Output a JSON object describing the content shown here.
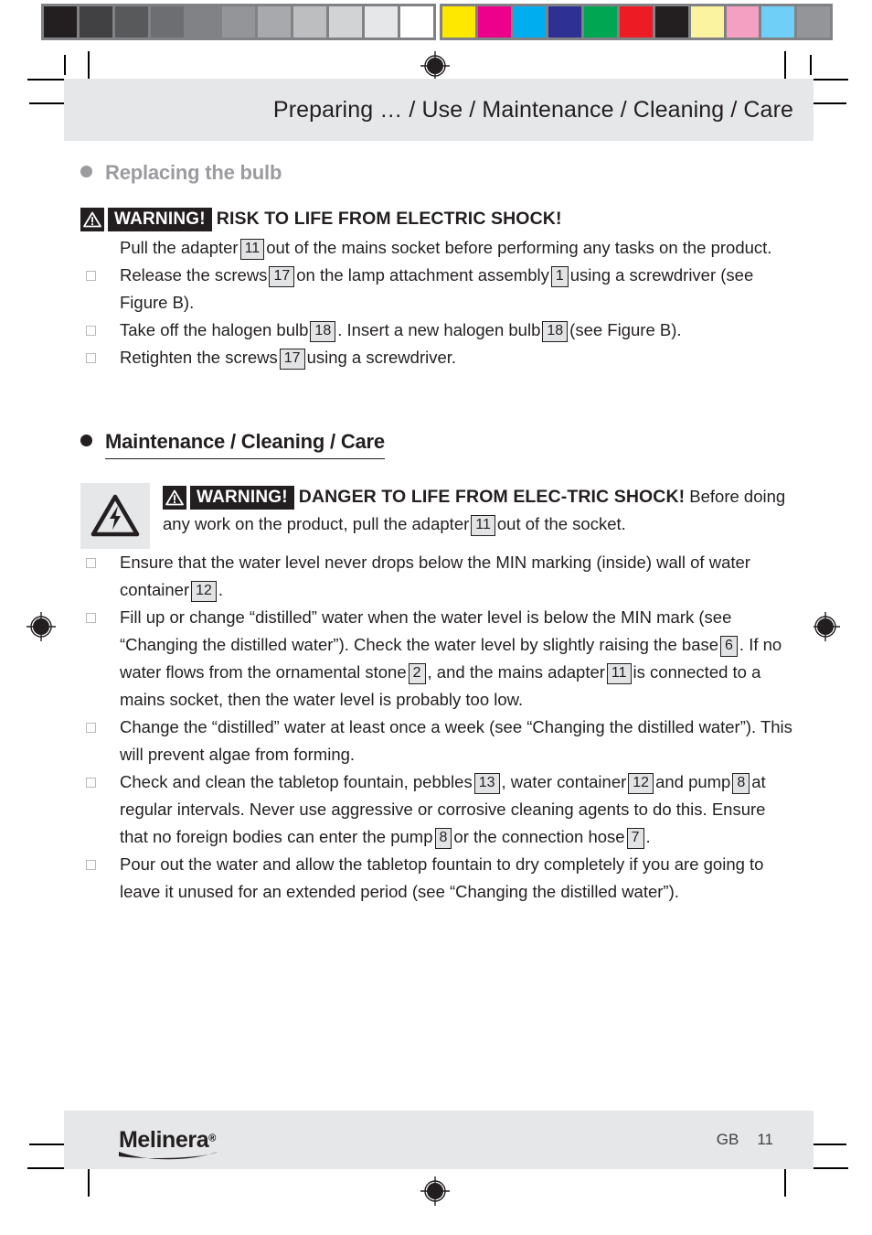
{
  "calibration": {
    "gray_ramp": [
      "#231f20",
      "#414042",
      "#58595b",
      "#6d6e71",
      "#808285",
      "#939598",
      "#a7a9ac",
      "#bcbec0",
      "#d1d3d4",
      "#e6e7e8",
      "#ffffff"
    ],
    "color_ramp": [
      "#ffe800",
      "#ec008c",
      "#00aeef",
      "#2e3192",
      "#00a651",
      "#ed1c24",
      "#231f20",
      "#fbf3a0",
      "#f4a0c2",
      "#6fcff6",
      "#939598"
    ],
    "strip_border": "#808285"
  },
  "header": {
    "title": "Preparing … / Use / Maintenance / Cleaning / Care",
    "background": "#e6e7e9"
  },
  "sections": [
    {
      "id": "replacing-the-bulb",
      "heading": "Replacing the bulb",
      "state": "continued",
      "color": "#9b9ba0"
    },
    {
      "id": "maintenance-cleaning-care",
      "heading": "Maintenance / Cleaning / Care",
      "state": "current",
      "color": "#231f20"
    }
  ],
  "warning_bulb": {
    "icon_label": "warning-triangle",
    "word": "WARNING!",
    "headline": "RISK TO LIFE FROM ELECTRIC SHOCK!",
    "body_before": "Pull the adapter",
    "ref": "11",
    "body_after": "out of the mains socket before performing any tasks on the product."
  },
  "bulb_steps": [
    {
      "p1": "Release the screws",
      "r1": "17",
      "p2": "on the lamp attachment assembly",
      "r2": "1",
      "p3": "using a screwdriver (see Figure B)."
    },
    {
      "p1": "Take off the halogen bulb",
      "r1": "18",
      "p2": ". Insert a new halogen bulb",
      "r2": "18",
      "p3": "(see Figure B)."
    },
    {
      "p1": "Retighten the screws",
      "r1": "17",
      "p2": "using a screwdriver.",
      "r2": "",
      "p3": ""
    }
  ],
  "warning_maintenance": {
    "icon_label": "electric-shock-triangle",
    "word": "WARNING!",
    "headline_1": "DANGER TO LIFE FROM ELEC-",
    "headline_2": "TRIC SHOCK!",
    "body_before": "Before doing any work on the product, pull the adapter",
    "ref": "11",
    "body_after": "out of the socket."
  },
  "maintenance_steps": [
    {
      "p1": "Ensure that the water level never drops below the MIN marking (inside) wall of water container",
      "r1": "12",
      "p2": ".",
      "r2": "",
      "p3": "",
      "r3": "",
      "p4": "",
      "r4": "",
      "p5": ""
    },
    {
      "p1": "Fill up or change “distilled” water when the water level is below the MIN mark (see “Changing the distilled water”). Check the water level by slightly raising the base",
      "r1": "6",
      "p2": ". If no water flows from the ornamental stone",
      "r2": "2",
      "p3": ", and the mains adapter",
      "r3": "11",
      "p4": "is connected to a mains socket, then the water level is probably too low.",
      "r4": "",
      "p5": ""
    },
    {
      "p1": "Change the “distilled” water at least once a week (see “Changing the distilled water”). This will prevent algae from forming.",
      "r1": "",
      "p2": "",
      "r2": "",
      "p3": "",
      "r3": "",
      "p4": "",
      "r4": "",
      "p5": ""
    },
    {
      "p1": "Check and clean the tabletop fountain, pebbles",
      "r1": "13",
      "p2": ", water container",
      "r2": "12",
      "p3": "and pump",
      "r3": "8",
      "p4": "at regular intervals. Never use aggressive or corrosive cleaning agents to do this. Ensure that no foreign bodies can enter the pump",
      "r4": "8",
      "p5": "or the connection hose",
      "r5": "7",
      "p6": "."
    },
    {
      "p1": "Pour out the water and allow the tabletop fountain to dry completely if you are going to leave it unused for an extended period (see “Changing the distilled water”).",
      "r1": "",
      "p2": "",
      "r2": "",
      "p3": "",
      "r3": "",
      "p4": "",
      "r4": "",
      "p5": ""
    }
  ],
  "footer": {
    "brand": "Melinera",
    "brand_registered": "®",
    "locale": "GB",
    "page_number": "11",
    "background": "#e6e7e9"
  }
}
